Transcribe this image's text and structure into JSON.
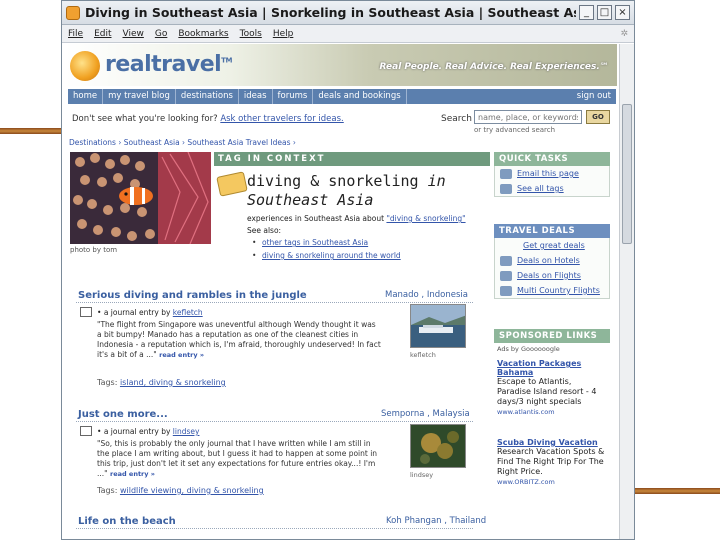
{
  "window": {
    "title": "Diving in Southeast Asia | Snorkeling in Southeast Asia | Southeast Asia Div...",
    "minimize": "_",
    "maximize": "□",
    "close": "×"
  },
  "menu": [
    "File",
    "Edit",
    "View",
    "Go",
    "Bookmarks",
    "Tools",
    "Help"
  ],
  "header": {
    "logo": "realtravel",
    "trademark": "TM",
    "tagline": "Real People. Real Advice. Real Experiences.℠"
  },
  "nav": {
    "items": [
      "home",
      "my travel blog",
      "destinations",
      "ideas",
      "forums",
      "deals and bookings"
    ],
    "signout": "sign out"
  },
  "ask": {
    "prompt": "Don't see what you're looking for?",
    "link": "Ask other travelers for ideas."
  },
  "search": {
    "label": "Search",
    "placeholder": "name, place, or keywords",
    "go": "GO",
    "advanced": "or try advanced search"
  },
  "breadcrumb": "Destinations › Southeast Asia › Southeast Asia Travel Ideas ›",
  "photo": {
    "credit": "photo by tom"
  },
  "tag_context": {
    "header": "TAG IN CONTEXT",
    "title_line1_pre": "diving & snorkeling",
    "title_line1_em": "in",
    "title_line2": "Southeast Asia",
    "exp_pre": "experiences in Southeast Asia about",
    "exp_link": "\"diving & snorkeling\"",
    "see_also": "See also:",
    "links": [
      "other tags in Southeast Asia",
      "diving & snorkeling around the world"
    ]
  },
  "quick_tasks": {
    "header": "QUICK TASKS",
    "items": [
      "Email this page",
      "See all tags"
    ]
  },
  "travel_deals": {
    "header": "TRAVEL DEALS",
    "items": [
      "Get great deals",
      "Deals on Hotels",
      "Deals on Flights",
      "Multi Country Flights"
    ]
  },
  "sponsored": {
    "header": "SPONSORED LINKS",
    "ads_by": "Ads by Goooooogle",
    "ads": [
      {
        "title": "Vacation Packages Bahama",
        "text": "Escape to Atlantis, Paradise Island resort - 4 days/3 night specials",
        "url": "www.atlantis.com"
      },
      {
        "title": "Scuba Diving Vacation",
        "text": "Research Vacation Spots & Find The Right Trip For The Right Price.",
        "url": "www.ORBITZ.com"
      }
    ]
  },
  "entries": [
    {
      "title": "Serious diving and rambles in the jungle",
      "location": "Manado , Indonesia",
      "by_pre": "a journal entry by",
      "author": "kefletch",
      "quote": "\"The flight from Singapore was uneventful although Wendy thought it was a bit bumpy! Manado has a reputation as one of the cleanest cities in Indonesia - a reputation which is, I'm afraid, thoroughly undeserved! In fact it's a bit of a ...\"",
      "more": "read entry »",
      "tags_label": "Tags:",
      "tags": "island, diving & snorkeling",
      "thumb_credit": "kefletch"
    },
    {
      "title": "Just one more...",
      "location": "Semporna , Malaysia",
      "by_pre": "a journal entry by",
      "author": "lindsey",
      "quote": "\"So, this is probably the only journal that I have written while I am still in the place I am writing about, but I guess it had to happen at some point in this trip, just don't let it set any expectations for future entries okay...! I'm ...\"",
      "more": "read entry »",
      "tags_label": "Tags:",
      "tags": "wildlife viewing, diving & snorkeling",
      "thumb_credit": "lindsey"
    },
    {
      "title": "Life on the beach",
      "location": "Koh Phangan , Thailand"
    }
  ]
}
